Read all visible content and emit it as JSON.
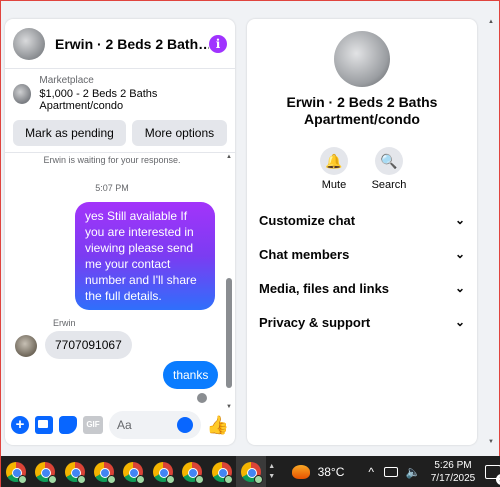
{
  "chat": {
    "title": "Erwin · 2 Beds 2 Bath…",
    "info_glyph": "i",
    "marketplace_label": "Marketplace",
    "listing": "$1,000 - 2 Beds 2 Baths Apartment/condo",
    "mark_pending_label": "Mark as pending",
    "more_options_label": "More options",
    "waiting_text": "Erwin is waiting for your response.",
    "time": "5:07 PM",
    "outgoing_message": "yes Still available If you are interested in viewing please send me your contact number and I'll share the full details.",
    "sender_name": "Erwin",
    "incoming_message": "7707091067",
    "thanks_message": "thanks",
    "composer_placeholder": "Aa",
    "gif_label": "GIF"
  },
  "info": {
    "name": "Erwin · 2 Beds 2 Baths Apartment/condo",
    "actions": [
      {
        "label": "Mute",
        "icon": "bell-icon"
      },
      {
        "label": "Search",
        "icon": "search-icon"
      }
    ],
    "sections": [
      {
        "label": "Customize chat"
      },
      {
        "label": "Chat members"
      },
      {
        "label": "Media, files and links"
      },
      {
        "label": "Privacy & support"
      }
    ]
  },
  "taskbar": {
    "app_count": 9,
    "temperature": "38°C",
    "time": "5:26 PM",
    "date": "7/17/2025",
    "notification_count": "3"
  },
  "colors": {
    "accent": "#0866ff",
    "bubble_blue": "#0a7cff",
    "bubble_gradient_top": "#a334fa",
    "info_purple": "#a033ff"
  }
}
